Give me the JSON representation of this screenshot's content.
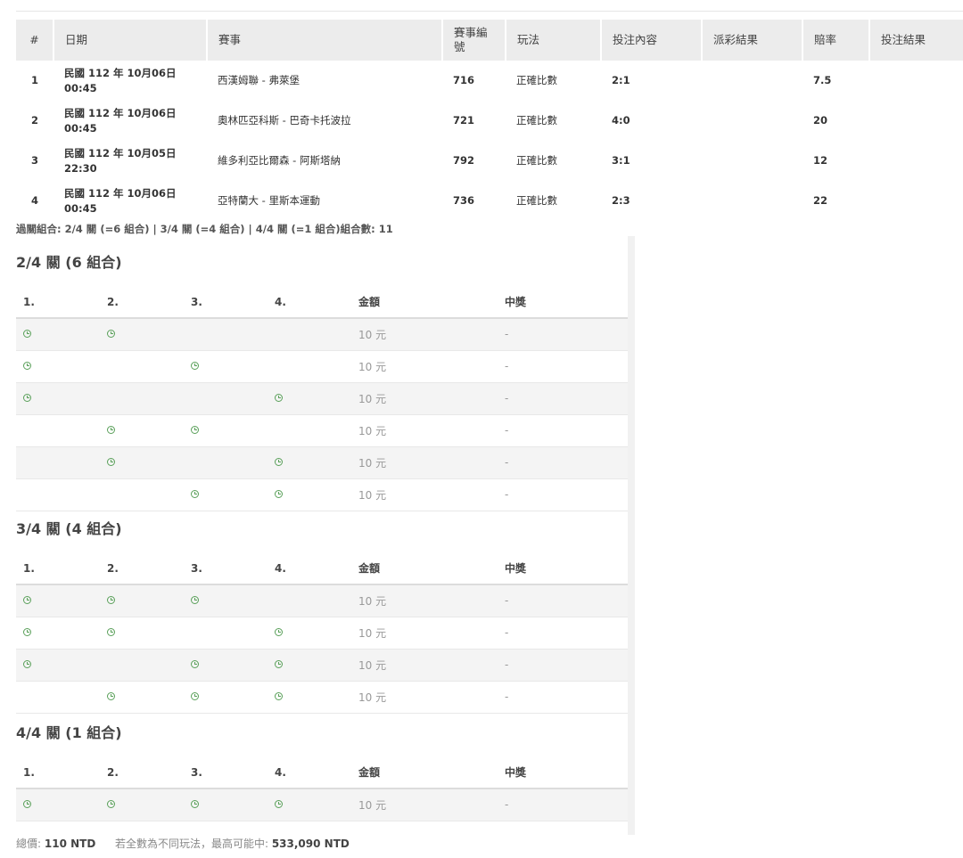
{
  "main_table": {
    "headers": [
      "#",
      "日期",
      "賽事",
      "賽事編號",
      "玩法",
      "投注內容",
      "派彩結果",
      "賠率",
      "投注結果"
    ],
    "rows": [
      {
        "num": "1",
        "date": "民國 112 年 10月06日",
        "time": "00:45",
        "event": "西漢姆聯 - 弗萊堡",
        "code": "716",
        "play": "正確比數",
        "content": "2:1",
        "payout": "",
        "odds": "7.5",
        "result": ""
      },
      {
        "num": "2",
        "date": "民國 112 年 10月06日",
        "time": "00:45",
        "event": "奧林匹亞科斯 - 巴奇卡托波拉",
        "code": "721",
        "play": "正確比數",
        "content": "4:0",
        "payout": "",
        "odds": "20",
        "result": ""
      },
      {
        "num": "3",
        "date": "民國 112 年 10月05日",
        "time": "22:30",
        "event": "維多利亞比爾森 - 阿斯塔納",
        "code": "792",
        "play": "正確比數",
        "content": "3:1",
        "payout": "",
        "odds": "12",
        "result": ""
      },
      {
        "num": "4",
        "date": "民國 112 年 10月06日",
        "time": "00:45",
        "event": "亞特蘭大 - 里斯本運動",
        "code": "736",
        "play": "正確比數",
        "content": "2:3",
        "payout": "",
        "odds": "22",
        "result": ""
      }
    ]
  },
  "summary": "過關組合: 2/4 關 (=6 組合) | 3/4 關 (=4 組合) | 4/4 關 (=1 組合)組合數: 11",
  "combo_headers": [
    "1.",
    "2.",
    "3.",
    "4.",
    "金額",
    "中獎"
  ],
  "sections": [
    {
      "title": "2/4 關 (6 組合)",
      "rows": [
        {
          "legs": [
            1,
            1,
            0,
            0
          ],
          "amount": "10 元",
          "win": "-"
        },
        {
          "legs": [
            1,
            0,
            1,
            0
          ],
          "amount": "10 元",
          "win": "-"
        },
        {
          "legs": [
            1,
            0,
            0,
            1
          ],
          "amount": "10 元",
          "win": "-"
        },
        {
          "legs": [
            0,
            1,
            1,
            0
          ],
          "amount": "10 元",
          "win": "-"
        },
        {
          "legs": [
            0,
            1,
            0,
            1
          ],
          "amount": "10 元",
          "win": "-"
        },
        {
          "legs": [
            0,
            0,
            1,
            1
          ],
          "amount": "10 元",
          "win": "-"
        }
      ]
    },
    {
      "title": "3/4 關 (4 組合)",
      "rows": [
        {
          "legs": [
            1,
            1,
            1,
            0
          ],
          "amount": "10 元",
          "win": "-"
        },
        {
          "legs": [
            1,
            1,
            0,
            1
          ],
          "amount": "10 元",
          "win": "-"
        },
        {
          "legs": [
            1,
            0,
            1,
            1
          ],
          "amount": "10 元",
          "win": "-"
        },
        {
          "legs": [
            0,
            1,
            1,
            1
          ],
          "amount": "10 元",
          "win": "-"
        }
      ]
    },
    {
      "title": "4/4 關 (1 組合)",
      "rows": [
        {
          "legs": [
            1,
            1,
            1,
            1
          ],
          "amount": "10 元",
          "win": "-"
        }
      ]
    }
  ],
  "footer": {
    "total_label": "總價:",
    "total_value": "110 NTD",
    "max_label": "若全數為不同玩法，最高可能中:",
    "max_value": "533,090 NTD"
  },
  "colors": {
    "clock_icon": "#5aa05a",
    "header_bg": "#ececec",
    "alt_row_bg": "#f4f4f4"
  }
}
